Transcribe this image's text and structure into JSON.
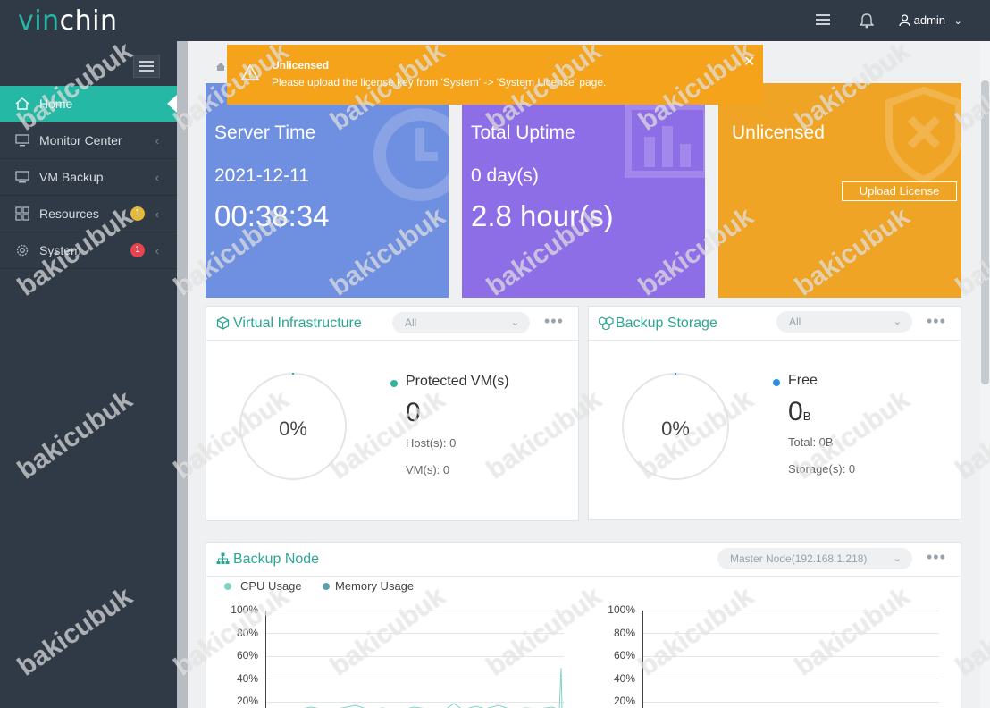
{
  "brand": {
    "part1": "vin",
    "part2": "chin"
  },
  "topbar": {
    "user": "admin"
  },
  "sidebar": {
    "items": [
      {
        "label": "Home"
      },
      {
        "label": "Monitor Center"
      },
      {
        "label": "VM Backup"
      },
      {
        "label": "Resources",
        "badge": "1",
        "badge_color": "#e5b93a"
      },
      {
        "label": "System",
        "badge": "1",
        "badge_color": "#e8434f"
      }
    ]
  },
  "notice": {
    "title": "Unlicensed",
    "message": "Please upload the license key from 'System' -> 'System License' page."
  },
  "cards": {
    "server_time": {
      "title": "Server Time",
      "date": "2021-12-11",
      "time": "00:38:34",
      "color": "#6f8fe0"
    },
    "uptime": {
      "title": "Total Uptime",
      "days": "0 day(s)",
      "hours": "2.8 hour(s)",
      "color": "#8e6ee6"
    },
    "license": {
      "title": "Unlicensed",
      "button": "Upload License",
      "color": "#f0a425"
    }
  },
  "virtual_infrastructure": {
    "title": "Virtual Infrastructure",
    "filter": "All",
    "percent": "0%",
    "legend": "Protected VM(s)",
    "value": "0",
    "hosts": "Host(s): 0",
    "vms": "VM(s): 0"
  },
  "backup_storage": {
    "title": "Backup Storage",
    "filter": "All",
    "percent": "0%",
    "legend": "Free",
    "value": "0",
    "unit": "B",
    "total": "Total: 0B",
    "storages": "Storage(s): 0"
  },
  "backup_node": {
    "title": "Backup Node",
    "node": "Master Node(192.168.1.218)",
    "legend": [
      "CPU Usage",
      "Memory Usage"
    ],
    "legend_colors": [
      "#7fd3c4",
      "#5b9fb3"
    ],
    "y_ticks": [
      "100%",
      "80%",
      "60%",
      "40%",
      "20%"
    ]
  },
  "watermark": "bakicubuk"
}
